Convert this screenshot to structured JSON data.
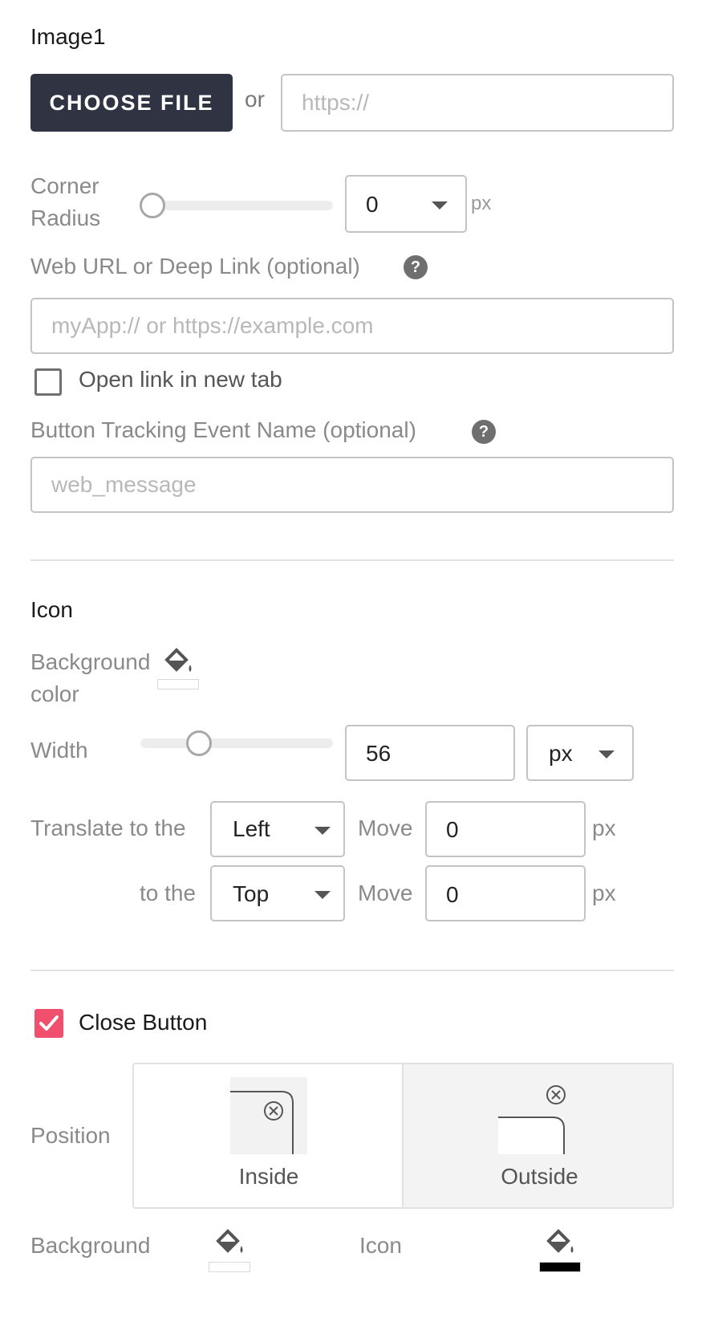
{
  "image_section": {
    "title": "Image1",
    "choose_file_label": "CHOOSE FILE",
    "or_label": "or",
    "url_placeholder": "https://",
    "corner_radius_label_line1": "Corner",
    "corner_radius_label_line2": "Radius",
    "corner_radius_value": "0",
    "corner_radius_unit": "px",
    "corner_radius_slider_level": 0,
    "web_url_label": "Web URL or Deep Link (optional)",
    "web_url_placeholder": "myApp:// or https://example.com",
    "open_new_tab_label": "Open link in new tab",
    "open_new_tab_checked": false,
    "tracking_label": "Button Tracking Event Name (optional)",
    "tracking_placeholder": "web_message"
  },
  "icon_section": {
    "title": "Icon",
    "bg_color_label_line1": "Background",
    "bg_color_label_line2": "color",
    "width_label": "Width",
    "width_value": "56",
    "width_unit": "px",
    "width_slider_level": 0.3,
    "translate_label": "Translate to the",
    "translate_x_dir": "Left",
    "move_label": "Move",
    "translate_x_value": "0",
    "px_label": "px",
    "to_the_label": "to the",
    "translate_y_dir": "Top",
    "translate_y_value": "0"
  },
  "close_section": {
    "title": "Close Button",
    "checked": true,
    "position_label": "Position",
    "inside_label": "Inside",
    "outside_label": "Outside",
    "selected": "Outside",
    "background_label": "Background",
    "icon_label": "Icon",
    "background_swatch": "#ffffff",
    "icon_swatch": "#000000"
  },
  "colors": {
    "dark_button": "#2f3342",
    "accent": "#f0506e"
  }
}
